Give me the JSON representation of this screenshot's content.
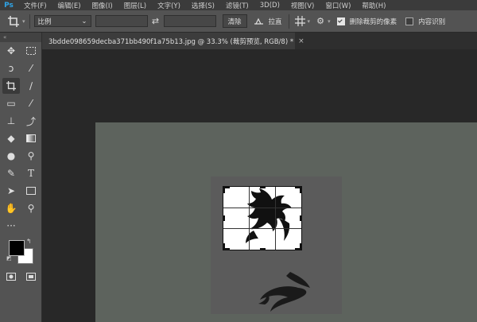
{
  "app": {
    "logo": "Ps"
  },
  "menu": [
    "文件(F)",
    "编辑(E)",
    "图像(I)",
    "图层(L)",
    "文字(Y)",
    "选择(S)",
    "滤镜(T)",
    "3D(D)",
    "视图(V)",
    "窗口(W)",
    "帮助(H)"
  ],
  "options": {
    "preset": "比例",
    "clear_label": "清除",
    "straighten_label": "拉直",
    "delete_cropped_label": "删除裁剪的像素",
    "delete_cropped_checked": true,
    "content_aware_label": "内容识别",
    "content_aware_checked": false
  },
  "document": {
    "tab_title": "3bdde098659decba371bb490f1a75b13.jpg @ 33.3% (裁剪预览, RGB/8) *",
    "close_symbol": "×"
  },
  "toolbar": {
    "tools": [
      "move-tool",
      "marquee-tool",
      "lasso-tool",
      "magic-wand-tool",
      "crop-tool",
      "eyedropper-tool",
      "healing-brush-tool",
      "brush-tool",
      "clone-stamp-tool",
      "history-brush-tool",
      "eraser-tool",
      "gradient-tool",
      "blur-tool",
      "dodge-tool",
      "pen-tool",
      "type-tool",
      "path-selection-tool",
      "rectangle-tool",
      "hand-tool",
      "zoom-tool"
    ],
    "active_tool": "crop-tool",
    "foreground_color": "#000000",
    "background_color": "#ffffff"
  },
  "colors": {
    "accent": "#2fa4e7",
    "panel": "#535353",
    "workspace": "#282828",
    "canvas": "#5d635d"
  }
}
